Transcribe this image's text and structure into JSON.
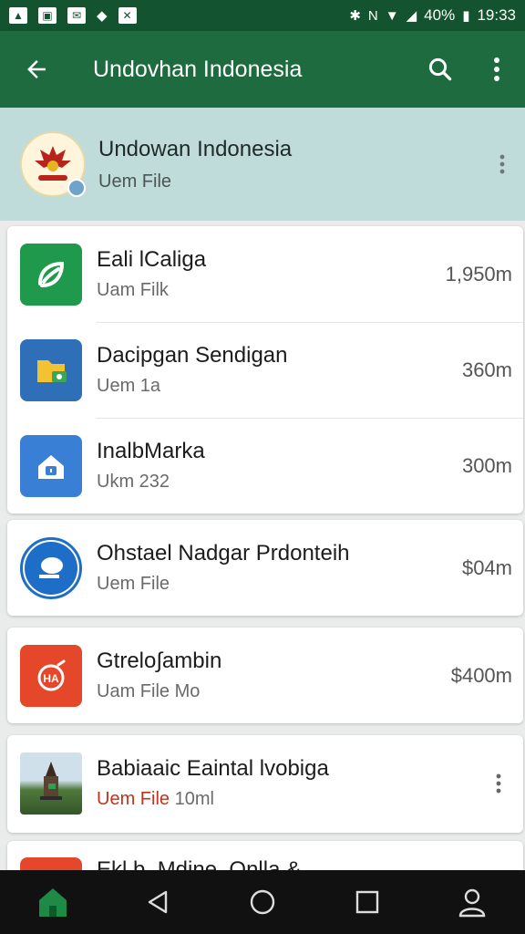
{
  "status_bar": {
    "battery": "40%",
    "time": "19:33"
  },
  "app_bar": {
    "title": "Undovhan Indonesia"
  },
  "header": {
    "title": "Undowan Indonesia",
    "subtitle": "Uem File"
  },
  "cards": [
    {
      "items": [
        {
          "title": "Eali lCaliga",
          "subtitle": "Uam Filk",
          "size": "1,950m",
          "icon": "leaf-icon",
          "color": "#1f9a4c"
        },
        {
          "title": "Dacipgan Sendigan",
          "subtitle": "Uem 1a",
          "size": "360m",
          "icon": "folder-icon",
          "color": "#2e6fb8"
        },
        {
          "title": "InalbMarka",
          "subtitle": "Ukm 232",
          "size": "300m",
          "icon": "home-icon",
          "color": "#3a7fd6"
        }
      ]
    },
    {
      "items": [
        {
          "title": "Ohstael Nadgar Prdonteih",
          "subtitle": "Uem File",
          "size": "$04m",
          "icon": "chat-bubble-icon",
          "color": "#1e6ec8"
        }
      ]
    },
    {
      "items": [
        {
          "title": "Gtrelo∫ambin",
          "subtitle": "Uam File Mo",
          "size": "$400m",
          "icon": "target-icon",
          "color": "#e4472a"
        }
      ]
    },
    {
      "items": [
        {
          "title": "Babiaaic Eaintal lvobiga",
          "subtitle_accent": "Uem File",
          "subtitle_rest": " 10ml",
          "icon": "landmark-photo-icon"
        }
      ]
    }
  ],
  "partial_row": {
    "title": "Ekl.b. Mdine. Onlla &"
  }
}
